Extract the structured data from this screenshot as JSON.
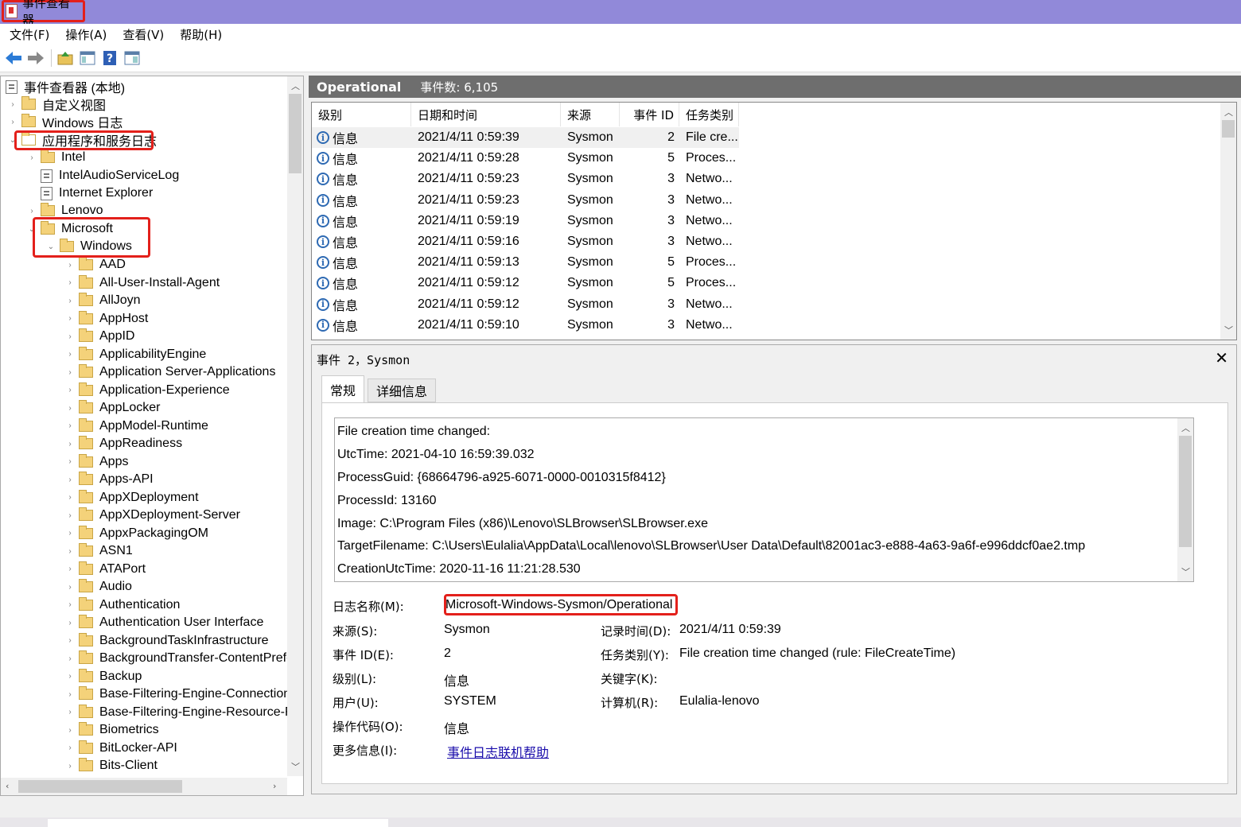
{
  "window": {
    "title": "事件查看器"
  },
  "menu": [
    "文件(F)",
    "操作(A)",
    "查看(V)",
    "帮助(H)"
  ],
  "toolbar": {
    "icons": [
      "back-arrow-icon",
      "forward-arrow-icon",
      "up-folder-icon",
      "console-tree-icon",
      "help-icon",
      "action-pane-icon"
    ],
    "help_glyph": "?"
  },
  "tree": {
    "root": "事件查看器 (本地)",
    "custom_views": "自定义视图",
    "windows_logs": "Windows 日志",
    "app_service_logs": "应用程序和服务日志",
    "level1": [
      "Intel",
      "IntelAudioServiceLog",
      "Internet Explorer",
      "Lenovo",
      "Microsoft"
    ],
    "windows": "Windows",
    "children": [
      "AAD",
      "All-User-Install-Agent",
      "AllJoyn",
      "AppHost",
      "AppID",
      "ApplicabilityEngine",
      "Application Server-Applications",
      "Application-Experience",
      "AppLocker",
      "AppModel-Runtime",
      "AppReadiness",
      "Apps",
      "Apps-API",
      "AppXDeployment",
      "AppXDeployment-Server",
      "AppxPackagingOM",
      "ASN1",
      "ATAPort",
      "Audio",
      "Authentication",
      "Authentication User Interface",
      "BackgroundTaskInfrastructure",
      "BackgroundTransfer-ContentPrefe",
      "Backup",
      "Base-Filtering-Engine-Connections",
      "Base-Filtering-Engine-Resource-Fl",
      "Biometrics",
      "BitLocker-API",
      "Bits-Client"
    ]
  },
  "log_header": {
    "name": "Operational",
    "count": "事件数: 6,105"
  },
  "event_list": {
    "columns": [
      "级别",
      "日期和时间",
      "来源",
      "事件 ID",
      "任务类别"
    ],
    "rows": [
      {
        "level": "信息",
        "datetime": "2021/4/11 0:59:39",
        "source": "Sysmon",
        "id": "2",
        "task": "File cre..."
      },
      {
        "level": "信息",
        "datetime": "2021/4/11 0:59:28",
        "source": "Sysmon",
        "id": "5",
        "task": "Proces..."
      },
      {
        "level": "信息",
        "datetime": "2021/4/11 0:59:23",
        "source": "Sysmon",
        "id": "3",
        "task": "Netwo..."
      },
      {
        "level": "信息",
        "datetime": "2021/4/11 0:59:23",
        "source": "Sysmon",
        "id": "3",
        "task": "Netwo..."
      },
      {
        "level": "信息",
        "datetime": "2021/4/11 0:59:19",
        "source": "Sysmon",
        "id": "3",
        "task": "Netwo..."
      },
      {
        "level": "信息",
        "datetime": "2021/4/11 0:59:16",
        "source": "Sysmon",
        "id": "3",
        "task": "Netwo..."
      },
      {
        "level": "信息",
        "datetime": "2021/4/11 0:59:13",
        "source": "Sysmon",
        "id": "5",
        "task": "Proces..."
      },
      {
        "level": "信息",
        "datetime": "2021/4/11 0:59:12",
        "source": "Sysmon",
        "id": "5",
        "task": "Proces..."
      },
      {
        "level": "信息",
        "datetime": "2021/4/11 0:59:12",
        "source": "Sysmon",
        "id": "3",
        "task": "Netwo..."
      },
      {
        "level": "信息",
        "datetime": "2021/4/11 0:59:10",
        "source": "Sysmon",
        "id": "3",
        "task": "Netwo..."
      }
    ]
  },
  "detail": {
    "title": "事件 2，Sysmon",
    "close": "✕",
    "tabs": [
      "常规",
      "详细信息"
    ],
    "message": [
      "File creation time changed:",
      "UtcTime: 2021-04-10 16:59:39.032",
      "ProcessGuid: {68664796-a925-6071-0000-0010315f8412}",
      "ProcessId: 13160",
      "Image: C:\\Program Files (x86)\\Lenovo\\SLBrowser\\SLBrowser.exe",
      "TargetFilename: C:\\Users\\Eulalia\\AppData\\Local\\lenovo\\SLBrowser\\User Data\\Default\\82001ac3-e888-4a63-9a6f-e996ddcf0ae2.tmp",
      "CreationUtcTime: 2020-11-16 11:21:28.530"
    ],
    "fields": {
      "log_name_label": "日志名称(M):",
      "log_name": "Microsoft-Windows-Sysmon/Operational",
      "source_label": "来源(S):",
      "source": "Sysmon",
      "event_id_label": "事件 ID(E):",
      "event_id": "2",
      "level_label": "级别(L):",
      "level": "信息",
      "user_label": "用户(U):",
      "user": "SYSTEM",
      "opcode_label": "操作代码(O):",
      "opcode": "信息",
      "more_info_label": "更多信息(I):",
      "more_info": "事件日志联机帮助",
      "logged_label": "记录时间(D):",
      "logged": "2021/4/11 0:59:39",
      "task_label": "任务类别(Y):",
      "task": "File creation time changed (rule: FileCreateTime)",
      "keywords_label": "关键字(K):",
      "keywords": "",
      "computer_label": "计算机(R):",
      "computer": "Eulalia-lenovo"
    }
  },
  "colors": {
    "titlebar": "#9189d9",
    "highlight": "#e3201b",
    "header": "#6e6e6e"
  }
}
